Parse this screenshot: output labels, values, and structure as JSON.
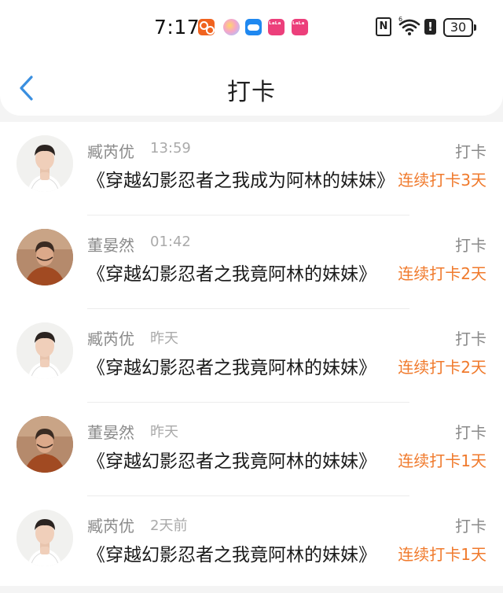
{
  "status_bar": {
    "time": "7:17",
    "battery": "30",
    "icons": [
      "app-icon-orange",
      "app-icon-gradient",
      "cloud-app-icon",
      "lala-app-icon",
      "lala-app-icon",
      "nfc-icon",
      "wifi-6-icon",
      "alert-icon",
      "battery-icon"
    ]
  },
  "header": {
    "title": "打卡",
    "back_icon": "chevron-left-icon"
  },
  "colors": {
    "accent": "#3a8fe0",
    "streak": "#f07a2c",
    "secondary_text": "#8a8a8a"
  },
  "entries": [
    {
      "username": "臧芮优",
      "time": "13:59",
      "label": "打卡",
      "book": "《穿越幻影忍者之我成为阿林的妹妹》",
      "streak": "连续打卡3天"
    },
    {
      "username": "董晏然",
      "time": "01:42",
      "label": "打卡",
      "book": "《穿越幻影忍者之我竟阿林的妹妹》",
      "streak": "连续打卡2天"
    },
    {
      "username": "臧芮优",
      "time": "昨天",
      "label": "打卡",
      "book": "《穿越幻影忍者之我竟阿林的妹妹》",
      "streak": "连续打卡2天"
    },
    {
      "username": "董晏然",
      "time": "昨天",
      "label": "打卡",
      "book": "《穿越幻影忍者之我竟阿林的妹妹》",
      "streak": "连续打卡1天"
    },
    {
      "username": "臧芮优",
      "time": "2天前",
      "label": "打卡",
      "book": "《穿越幻影忍者之我竟阿林的妹妹》",
      "streak": "连续打卡1天"
    }
  ]
}
